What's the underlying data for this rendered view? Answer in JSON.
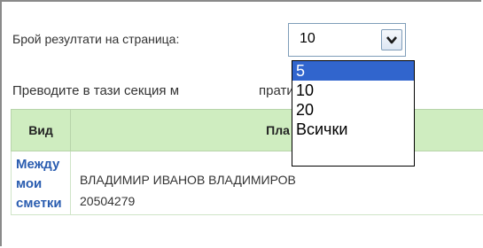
{
  "per_page": {
    "label": "Брой резултати на страница:",
    "selected": "10",
    "options": [
      "5",
      "10",
      "20",
      "Всички"
    ],
    "highlighted": "5"
  },
  "intro_text_left": "Преводите в тази секция м",
  "intro_text_right": "пратите",
  "table": {
    "headers": [
      "Вид",
      "Пла"
    ],
    "rows": [
      {
        "type": "Между мои сметки",
        "type_lines": [
          "Между",
          "мои",
          "сметки"
        ],
        "payer": [
          "ВЛАДИМИР ИВАНОВ ВЛАДИМИРОВ",
          "20504279"
        ]
      }
    ]
  },
  "colors": {
    "header_bg": "#cfedc0",
    "link": "#2a5db0",
    "highlight": "#3165cd"
  }
}
